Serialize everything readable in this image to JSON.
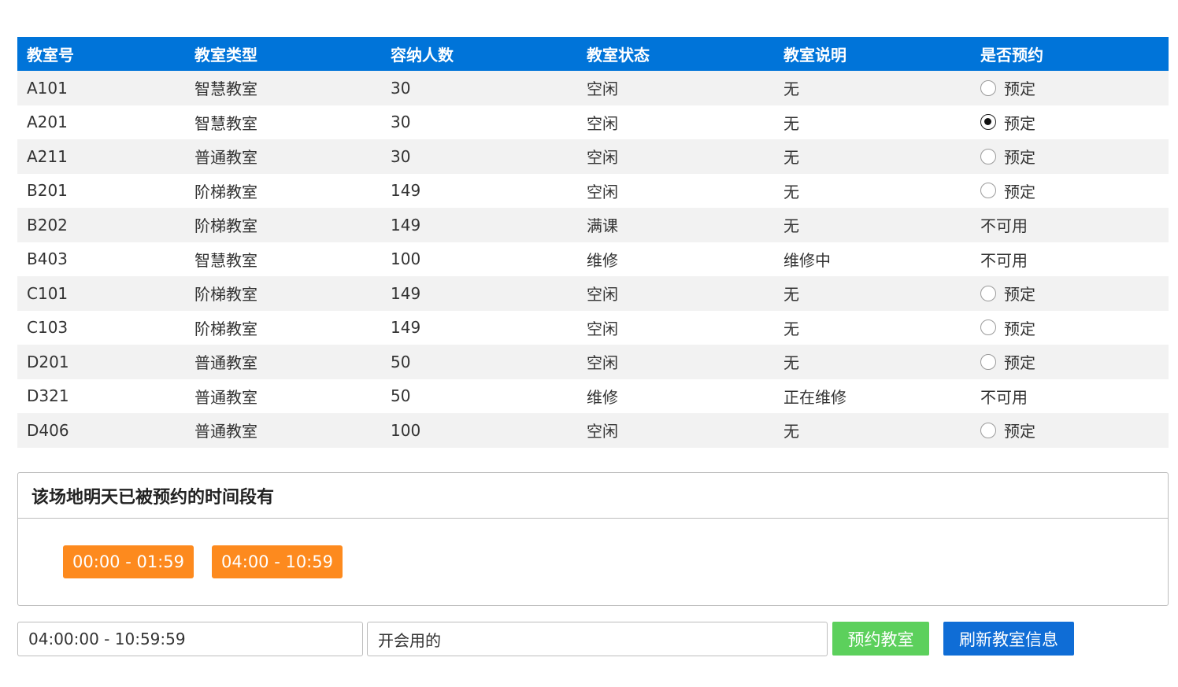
{
  "table": {
    "headers": [
      "教室号",
      "教室类型",
      "容纳人数",
      "教室状态",
      "教室说明",
      "是否预约"
    ],
    "rows": [
      {
        "room": "A101",
        "type": "智慧教室",
        "capacity": "30",
        "status": "空闲",
        "note": "无",
        "reserve": "预定",
        "available": true,
        "selected": false
      },
      {
        "room": "A201",
        "type": "智慧教室",
        "capacity": "30",
        "status": "空闲",
        "note": "无",
        "reserve": "预定",
        "available": true,
        "selected": true
      },
      {
        "room": "A211",
        "type": "普通教室",
        "capacity": "30",
        "status": "空闲",
        "note": "无",
        "reserve": "预定",
        "available": true,
        "selected": false
      },
      {
        "room": "B201",
        "type": "阶梯教室",
        "capacity": "149",
        "status": "空闲",
        "note": "无",
        "reserve": "预定",
        "available": true,
        "selected": false
      },
      {
        "room": "B202",
        "type": "阶梯教室",
        "capacity": "149",
        "status": "满课",
        "note": "无",
        "reserve": "不可用",
        "available": false,
        "selected": false
      },
      {
        "room": "B403",
        "type": "智慧教室",
        "capacity": "100",
        "status": "维修",
        "note": "维修中",
        "reserve": "不可用",
        "available": false,
        "selected": false
      },
      {
        "room": "C101",
        "type": "阶梯教室",
        "capacity": "149",
        "status": "空闲",
        "note": "无",
        "reserve": "预定",
        "available": true,
        "selected": false
      },
      {
        "room": "C103",
        "type": "阶梯教室",
        "capacity": "149",
        "status": "空闲",
        "note": "无",
        "reserve": "预定",
        "available": true,
        "selected": false
      },
      {
        "room": "D201",
        "type": "普通教室",
        "capacity": "50",
        "status": "空闲",
        "note": "无",
        "reserve": "预定",
        "available": true,
        "selected": false
      },
      {
        "room": "D321",
        "type": "普通教室",
        "capacity": "50",
        "status": "维修",
        "note": "正在维修",
        "reserve": "不可用",
        "available": false,
        "selected": false
      },
      {
        "room": "D406",
        "type": "普通教室",
        "capacity": "100",
        "status": "空闲",
        "note": "无",
        "reserve": "预定",
        "available": true,
        "selected": false
      }
    ]
  },
  "booked_panel": {
    "title": "该场地明天已被预约的时间段有",
    "slots": [
      "00:00 - 01:59",
      "04:00 - 10:59"
    ]
  },
  "form": {
    "time_value": "04:00:00 - 10:59:59",
    "note_value": "开会用的",
    "book_button": "预约教室",
    "refresh_button": "刷新教室信息"
  },
  "colors": {
    "header_bg": "#0074d9",
    "slot_bg": "#fd8a1e",
    "book_button": "#5cd05c",
    "refresh_button": "#0f6dd6"
  }
}
